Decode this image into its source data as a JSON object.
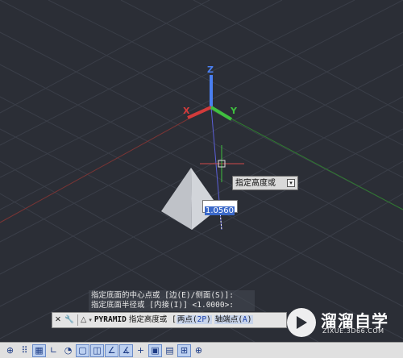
{
  "viewport": {
    "axes": {
      "z": "Z",
      "x": "X",
      "y": "Y"
    },
    "colors": {
      "background": "#2b2e36",
      "x_axis": "#d23b3b",
      "y_axis": "#3fbf3f",
      "z_axis": "#4a7ff0",
      "object": "#c9ccd2"
    }
  },
  "tooltip": {
    "text": "指定高度或",
    "button_icon": "▾"
  },
  "dynamic_input": {
    "value": "1.0560"
  },
  "command_history": {
    "lines": [
      "指定底面的中心点或 [边(E)/侧面(S)]:",
      "指定底面半径或 [内接(I)] <1.0000>:"
    ]
  },
  "command_line": {
    "close_icon": "✕",
    "customize_icon": "🔧",
    "command_icon": "△",
    "command_name": "PYRAMID",
    "prompt": "指定高度或 [",
    "options": [
      {
        "label": "两点(",
        "key": "2P",
        "close": ")"
      },
      {
        "label": "轴端点(",
        "key": "A",
        "close": ")"
      }
    ]
  },
  "status_bar": {
    "buttons": [
      "⊕",
      "⠿",
      "▦",
      "∟",
      "◔",
      "▢",
      "◫",
      "∠",
      "∡",
      "+",
      "▣",
      "▤",
      "⊞",
      "⊕"
    ]
  },
  "watermark": {
    "brand": "溜溜自学",
    "url": "ZIXUE.3D66.COM"
  }
}
